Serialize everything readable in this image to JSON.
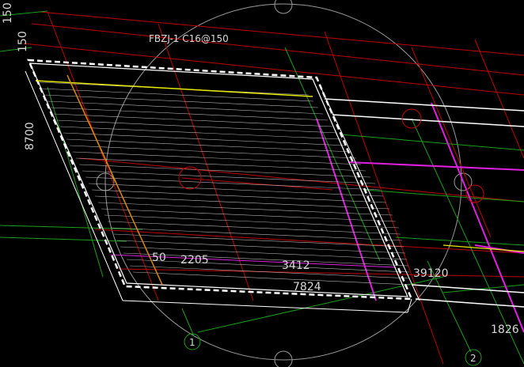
{
  "view": {
    "background": "#000000",
    "rebar_label": "FBZJ-1 C16@150",
    "dims": {
      "top_left_a": "150",
      "top_left_b": "150",
      "left_vertical": "8700",
      "left_small": "50",
      "bottom_1": "2205",
      "bottom_2": "3412",
      "bottom_3": "7824",
      "right_1": "39120",
      "right_2": "1826"
    },
    "axis_markers": {
      "axis_1": "1",
      "axis_2": "2"
    },
    "colors": {
      "slab_outline": "#ffffff",
      "hatch": "#cfcfcf",
      "grid_red": "#c00000",
      "grid_green": "#1aa01a",
      "magenta": "#e020e0",
      "yellow": "#e8e800",
      "orange": "#e08a00",
      "circle": "#9a9a9a"
    }
  }
}
